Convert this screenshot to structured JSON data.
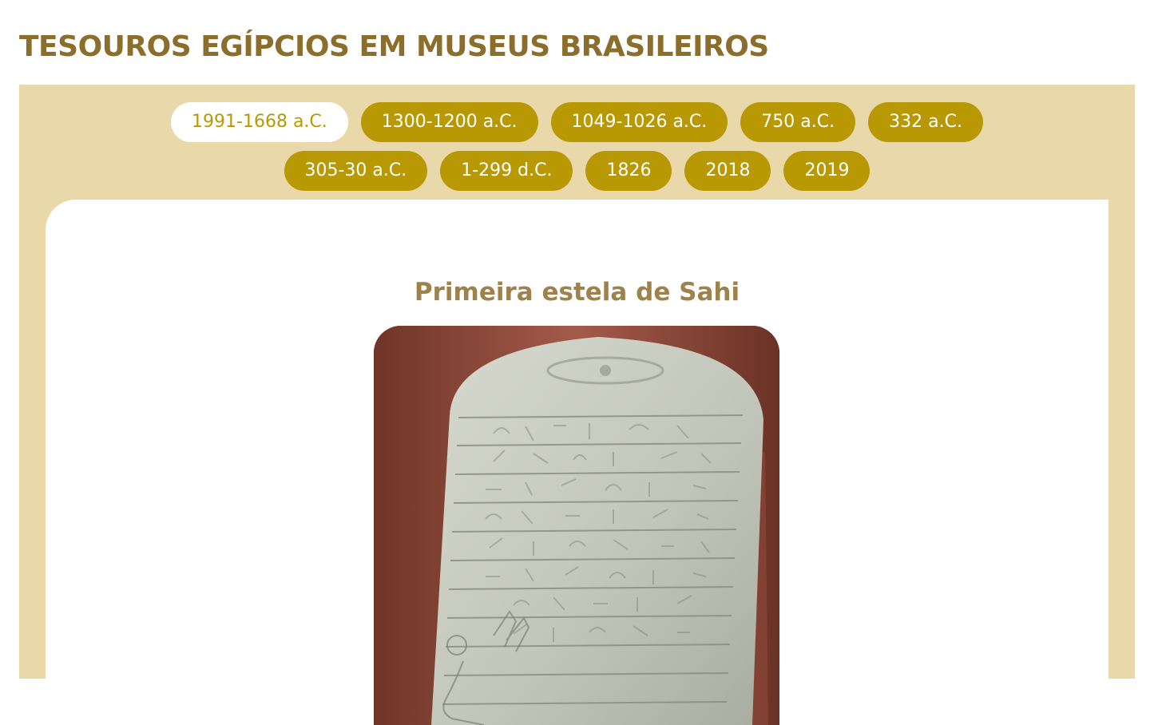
{
  "page": {
    "title": "TESOUROS EGÍPCIOS EM MUSEUS BRASILEIROS"
  },
  "timeline": {
    "tabs": [
      {
        "label": "1991-1668 a.C.",
        "active": true
      },
      {
        "label": "1300-1200 a.C.",
        "active": false
      },
      {
        "label": "1049-1026 a.C.",
        "active": false
      },
      {
        "label": "750 a.C.",
        "active": false
      },
      {
        "label": "332 a.C.",
        "active": false
      },
      {
        "label": "305-30 a.C.",
        "active": false
      },
      {
        "label": "1-299 d.C.",
        "active": false
      },
      {
        "label": "1826",
        "active": false
      },
      {
        "label": "2018",
        "active": false
      },
      {
        "label": "2019",
        "active": false
      }
    ]
  },
  "content": {
    "item_title": "Primeira estela de Sahi",
    "image_subject": "stela-photo"
  },
  "colors": {
    "heading": "#8c6e2c",
    "panel_background": "#e9d8a9",
    "tab_background": "#b89903",
    "tab_text": "#ffffff",
    "active_tab_background": "#ffffff",
    "item_title": "#9f814b"
  }
}
